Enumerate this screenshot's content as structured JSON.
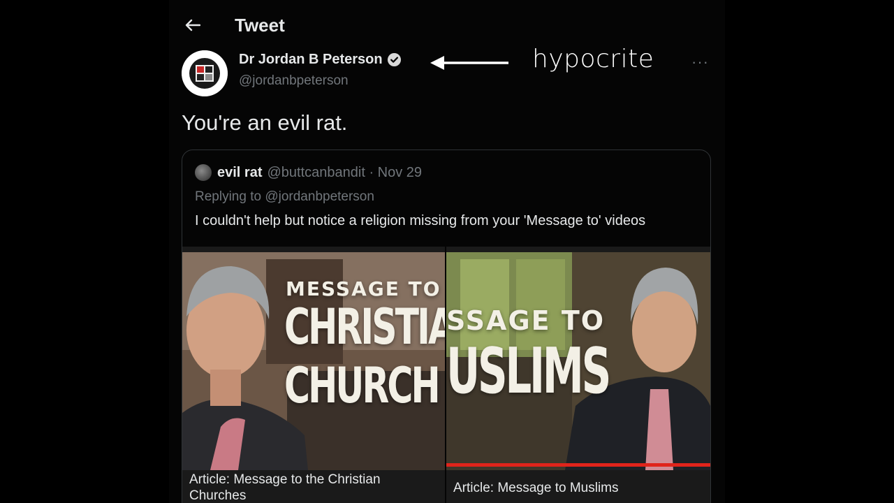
{
  "header": {
    "title": "Tweet",
    "back_icon": "arrow-left-icon"
  },
  "tweet": {
    "display_name": "Dr Jordan B Peterson",
    "verified_icon": "verified-badge-icon",
    "handle": "@jordanbpeterson",
    "text": "You're an evil rat.",
    "more_icon": "more-dots-icon",
    "more_label": "···"
  },
  "annotation": {
    "text": "hypocrite",
    "arrow_icon": "arrow-left-icon"
  },
  "quoted_tweet": {
    "name": "evil rat",
    "handle_date": "@buttcanbandit · Nov 29",
    "replying_to": "Replying to @jordanbpeterson",
    "text": "I couldn't help but notice a religion missing from your 'Message to' videos"
  },
  "media_cards": [
    {
      "thumb_line1": "MESSAGE TO T",
      "thumb_line2": "CHRISTIA",
      "thumb_line3": "CHURCH",
      "title": "Article: Message to the Christian Churches"
    },
    {
      "thumb_line1": "SSAGE TO",
      "thumb_line2": "USLIMS",
      "title": "Article: Message to Muslims"
    }
  ],
  "colors": {
    "accent_red": "#e0241b",
    "muted": "#71767b",
    "text": "#e7e9ea"
  }
}
